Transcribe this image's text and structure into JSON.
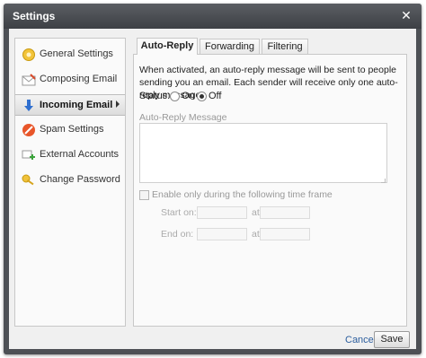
{
  "window": {
    "title": "Settings"
  },
  "sidebar": {
    "items": [
      {
        "label": "General Settings",
        "icon": "gear-icon"
      },
      {
        "label": "Composing Email",
        "icon": "envelope-icon"
      },
      {
        "label": "Incoming Email",
        "icon": "download-icon"
      },
      {
        "label": "Spam Settings",
        "icon": "no-entry-icon"
      },
      {
        "label": "External Accounts",
        "icon": "add-account-icon"
      },
      {
        "label": "Change Password",
        "icon": "key-icon"
      }
    ],
    "active_index": 2
  },
  "tabs": [
    {
      "label": "Auto-Reply"
    },
    {
      "label": "Forwarding"
    },
    {
      "label": "Filtering"
    }
  ],
  "active_tab": "Auto-Reply",
  "autoreply": {
    "description": "When activated, an auto-reply message will be sent to people sending you an email. Each sender will receive only one auto-reply message.",
    "status_label": "Status:",
    "options": [
      "On",
      "Off"
    ],
    "selected": "Off",
    "message_label": "Auto-Reply Message",
    "message_value": "",
    "timeframe_label": "Enable only during the following time frame",
    "timeframe_enabled": false,
    "start_label": "Start on:",
    "end_label": "End on:",
    "at_label": "at"
  },
  "footer": {
    "cancel_label": "Cancel",
    "save_label": "Save"
  },
  "colors": {
    "titlebar": "#4d5055",
    "link": "#2c5e9e",
    "panel": "#fafafa"
  }
}
